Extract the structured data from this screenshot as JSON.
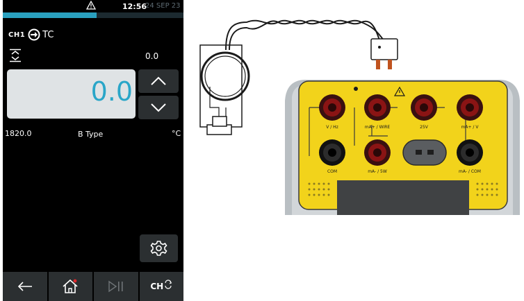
{
  "status": {
    "time": "12:56",
    "date": "24 SEP 23",
    "progress": 0.52,
    "warning_icon": "warning-triangle-icon"
  },
  "channel": {
    "label": "CH1",
    "mode_icon": "output-arrow-icon",
    "type": "TC"
  },
  "readout": {
    "top_value": "0.0",
    "main_value": "0.0",
    "min_value": "1820.0",
    "thermocouple_type": "B Type",
    "unit": "°C"
  },
  "nav": {
    "back_icon": "back-arrow-icon",
    "home_icon": "home-icon",
    "play_pause_icon": "play-pause-icon",
    "channel_label": "CH"
  },
  "colors": {
    "accent": "#2aa6c8",
    "screen_bg": "#000000",
    "button_bg": "#2b2f31",
    "value_box_bg": "#dfe3e5",
    "device_yellow": "#f2d31b",
    "terminal_red": "#8a1414"
  },
  "illustration": {
    "terminal_labels": [
      "V / Hz",
      "mA+ / WIRE",
      "25V",
      "mA+ / V",
      "COM",
      "mA- / 5W",
      "mA- / COM"
    ]
  }
}
